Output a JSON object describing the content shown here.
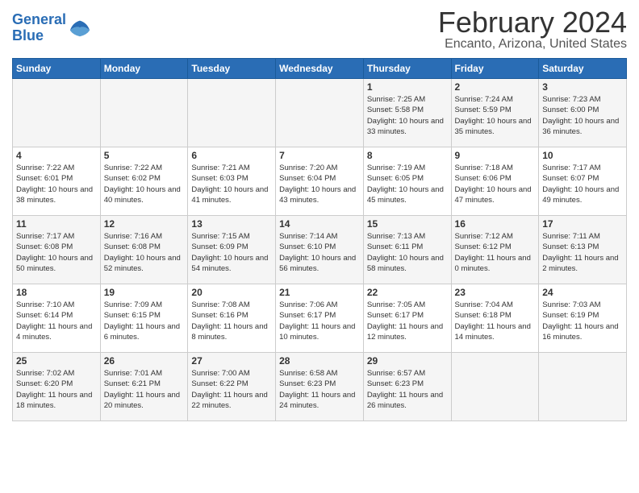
{
  "logo": {
    "line1": "General",
    "line2": "Blue"
  },
  "title": "February 2024",
  "location": "Encanto, Arizona, United States",
  "days_of_week": [
    "Sunday",
    "Monday",
    "Tuesday",
    "Wednesday",
    "Thursday",
    "Friday",
    "Saturday"
  ],
  "weeks": [
    [
      {
        "day": "",
        "sunrise": "",
        "sunset": "",
        "daylight": ""
      },
      {
        "day": "",
        "sunrise": "",
        "sunset": "",
        "daylight": ""
      },
      {
        "day": "",
        "sunrise": "",
        "sunset": "",
        "daylight": ""
      },
      {
        "day": "",
        "sunrise": "",
        "sunset": "",
        "daylight": ""
      },
      {
        "day": "1",
        "sunrise": "Sunrise: 7:25 AM",
        "sunset": "Sunset: 5:58 PM",
        "daylight": "Daylight: 10 hours and 33 minutes."
      },
      {
        "day": "2",
        "sunrise": "Sunrise: 7:24 AM",
        "sunset": "Sunset: 5:59 PM",
        "daylight": "Daylight: 10 hours and 35 minutes."
      },
      {
        "day": "3",
        "sunrise": "Sunrise: 7:23 AM",
        "sunset": "Sunset: 6:00 PM",
        "daylight": "Daylight: 10 hours and 36 minutes."
      }
    ],
    [
      {
        "day": "4",
        "sunrise": "Sunrise: 7:22 AM",
        "sunset": "Sunset: 6:01 PM",
        "daylight": "Daylight: 10 hours and 38 minutes."
      },
      {
        "day": "5",
        "sunrise": "Sunrise: 7:22 AM",
        "sunset": "Sunset: 6:02 PM",
        "daylight": "Daylight: 10 hours and 40 minutes."
      },
      {
        "day": "6",
        "sunrise": "Sunrise: 7:21 AM",
        "sunset": "Sunset: 6:03 PM",
        "daylight": "Daylight: 10 hours and 41 minutes."
      },
      {
        "day": "7",
        "sunrise": "Sunrise: 7:20 AM",
        "sunset": "Sunset: 6:04 PM",
        "daylight": "Daylight: 10 hours and 43 minutes."
      },
      {
        "day": "8",
        "sunrise": "Sunrise: 7:19 AM",
        "sunset": "Sunset: 6:05 PM",
        "daylight": "Daylight: 10 hours and 45 minutes."
      },
      {
        "day": "9",
        "sunrise": "Sunrise: 7:18 AM",
        "sunset": "Sunset: 6:06 PM",
        "daylight": "Daylight: 10 hours and 47 minutes."
      },
      {
        "day": "10",
        "sunrise": "Sunrise: 7:17 AM",
        "sunset": "Sunset: 6:07 PM",
        "daylight": "Daylight: 10 hours and 49 minutes."
      }
    ],
    [
      {
        "day": "11",
        "sunrise": "Sunrise: 7:17 AM",
        "sunset": "Sunset: 6:08 PM",
        "daylight": "Daylight: 10 hours and 50 minutes."
      },
      {
        "day": "12",
        "sunrise": "Sunrise: 7:16 AM",
        "sunset": "Sunset: 6:08 PM",
        "daylight": "Daylight: 10 hours and 52 minutes."
      },
      {
        "day": "13",
        "sunrise": "Sunrise: 7:15 AM",
        "sunset": "Sunset: 6:09 PM",
        "daylight": "Daylight: 10 hours and 54 minutes."
      },
      {
        "day": "14",
        "sunrise": "Sunrise: 7:14 AM",
        "sunset": "Sunset: 6:10 PM",
        "daylight": "Daylight: 10 hours and 56 minutes."
      },
      {
        "day": "15",
        "sunrise": "Sunrise: 7:13 AM",
        "sunset": "Sunset: 6:11 PM",
        "daylight": "Daylight: 10 hours and 58 minutes."
      },
      {
        "day": "16",
        "sunrise": "Sunrise: 7:12 AM",
        "sunset": "Sunset: 6:12 PM",
        "daylight": "Daylight: 11 hours and 0 minutes."
      },
      {
        "day": "17",
        "sunrise": "Sunrise: 7:11 AM",
        "sunset": "Sunset: 6:13 PM",
        "daylight": "Daylight: 11 hours and 2 minutes."
      }
    ],
    [
      {
        "day": "18",
        "sunrise": "Sunrise: 7:10 AM",
        "sunset": "Sunset: 6:14 PM",
        "daylight": "Daylight: 11 hours and 4 minutes."
      },
      {
        "day": "19",
        "sunrise": "Sunrise: 7:09 AM",
        "sunset": "Sunset: 6:15 PM",
        "daylight": "Daylight: 11 hours and 6 minutes."
      },
      {
        "day": "20",
        "sunrise": "Sunrise: 7:08 AM",
        "sunset": "Sunset: 6:16 PM",
        "daylight": "Daylight: 11 hours and 8 minutes."
      },
      {
        "day": "21",
        "sunrise": "Sunrise: 7:06 AM",
        "sunset": "Sunset: 6:17 PM",
        "daylight": "Daylight: 11 hours and 10 minutes."
      },
      {
        "day": "22",
        "sunrise": "Sunrise: 7:05 AM",
        "sunset": "Sunset: 6:17 PM",
        "daylight": "Daylight: 11 hours and 12 minutes."
      },
      {
        "day": "23",
        "sunrise": "Sunrise: 7:04 AM",
        "sunset": "Sunset: 6:18 PM",
        "daylight": "Daylight: 11 hours and 14 minutes."
      },
      {
        "day": "24",
        "sunrise": "Sunrise: 7:03 AM",
        "sunset": "Sunset: 6:19 PM",
        "daylight": "Daylight: 11 hours and 16 minutes."
      }
    ],
    [
      {
        "day": "25",
        "sunrise": "Sunrise: 7:02 AM",
        "sunset": "Sunset: 6:20 PM",
        "daylight": "Daylight: 11 hours and 18 minutes."
      },
      {
        "day": "26",
        "sunrise": "Sunrise: 7:01 AM",
        "sunset": "Sunset: 6:21 PM",
        "daylight": "Daylight: 11 hours and 20 minutes."
      },
      {
        "day": "27",
        "sunrise": "Sunrise: 7:00 AM",
        "sunset": "Sunset: 6:22 PM",
        "daylight": "Daylight: 11 hours and 22 minutes."
      },
      {
        "day": "28",
        "sunrise": "Sunrise: 6:58 AM",
        "sunset": "Sunset: 6:23 PM",
        "daylight": "Daylight: 11 hours and 24 minutes."
      },
      {
        "day": "29",
        "sunrise": "Sunrise: 6:57 AM",
        "sunset": "Sunset: 6:23 PM",
        "daylight": "Daylight: 11 hours and 26 minutes."
      },
      {
        "day": "",
        "sunrise": "",
        "sunset": "",
        "daylight": ""
      },
      {
        "day": "",
        "sunrise": "",
        "sunset": "",
        "daylight": ""
      }
    ]
  ]
}
